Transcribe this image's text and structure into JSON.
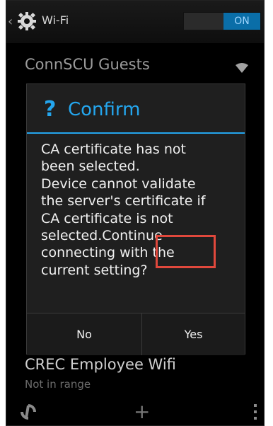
{
  "actionbar": {
    "title": "Wi-Fi",
    "toggle_label": "ON"
  },
  "networks": [
    {
      "name": "ConnSCU Guests",
      "status": ""
    },
    {
      "name": "CREC Employee Wifi",
      "status": "Not in range"
    }
  ],
  "dialog": {
    "title": "Confirm",
    "icon_glyph": "?",
    "message": "CA certificate has not\nbeen selected.\nDevice cannot validate\nthe server's certificate if\nCA certificate is not\nselected.Continue\nconnecting with the\ncurrent setting?",
    "no_label": "No",
    "yes_label": "Yes"
  },
  "colors": {
    "accent": "#24a6ee",
    "toggle_on": "#0a6ea8",
    "highlight": "#e0483c"
  },
  "bottombar": {
    "plus_glyph": "+"
  }
}
